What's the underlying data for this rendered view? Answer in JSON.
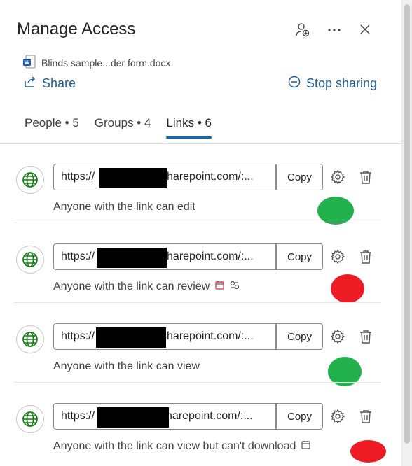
{
  "panel": {
    "title": "Manage Access"
  },
  "file": {
    "name": "Blinds sample...der form.docx"
  },
  "actions": {
    "share": "Share",
    "stop_sharing": "Stop sharing"
  },
  "tabs": [
    {
      "label": "People • 5"
    },
    {
      "label": "Groups • 4"
    },
    {
      "label": "Links • 6"
    }
  ],
  "links": [
    {
      "url_prefix": "https://",
      "url_suffix": "sharepoint.com/:...",
      "copy": "Copy",
      "permission": "Anyone with the link can edit",
      "status_color": "#22b14c"
    },
    {
      "url_prefix": "https://",
      "url_suffix": "sharepoint.com/:...",
      "copy": "Copy",
      "permission": "Anyone with the link can review",
      "status_color": "#ed1c24"
    },
    {
      "url_prefix": "https://",
      "url_suffix": "sharepoint.com/:...",
      "copy": "Copy",
      "permission": "Anyone with the link can view",
      "status_color": "#22b14c"
    },
    {
      "url_prefix": "https://",
      "url_suffix": "harepoint.com/:...",
      "copy": "Copy",
      "permission": "Anyone with the link can view but can't download",
      "status_color": "#ed1c24"
    }
  ],
  "colors": {
    "accent": "#0f6cbd",
    "link_text": "#1f5e9c",
    "globe": "#107c10"
  }
}
